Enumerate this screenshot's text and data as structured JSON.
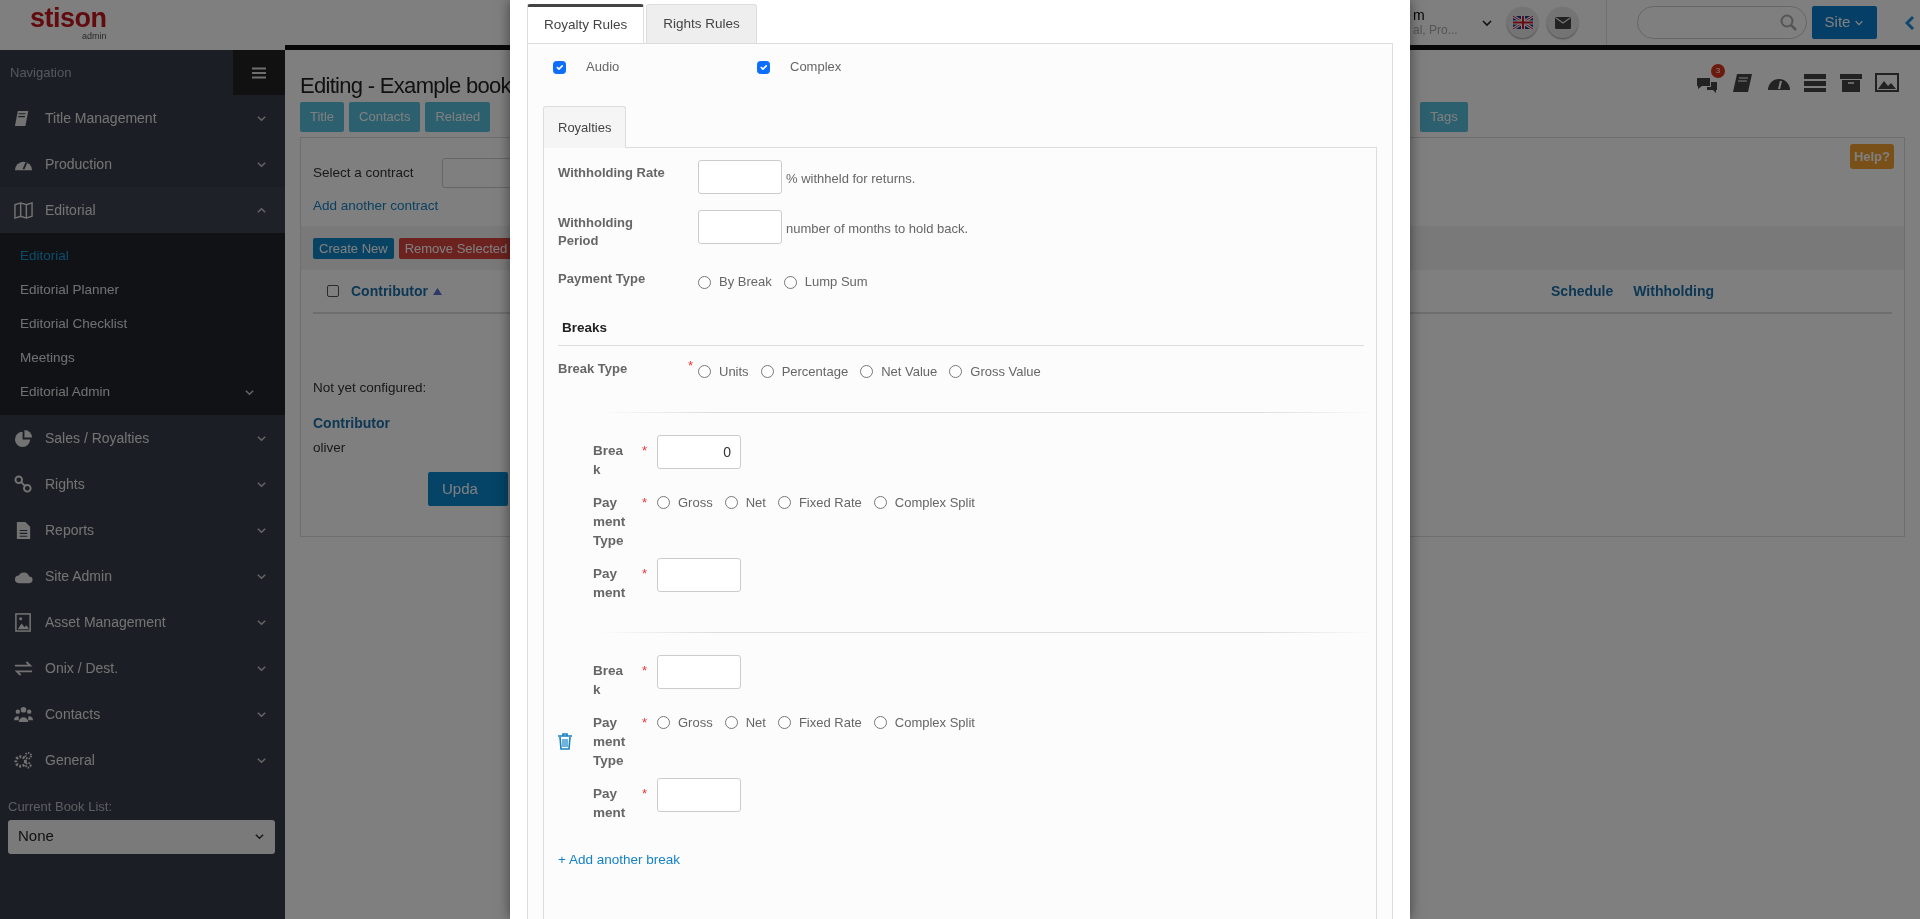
{
  "header": {
    "logo": "stison",
    "logo_sub": "admin",
    "user_name": "m",
    "user_detail": "al, Pro...",
    "site_button": "Site"
  },
  "sidebar": {
    "title": "Navigation",
    "items": [
      {
        "label": "Title Management",
        "expanded": false
      },
      {
        "label": "Production",
        "expanded": false
      },
      {
        "label": "Editorial",
        "expanded": true,
        "children": [
          {
            "label": "Editorial",
            "selected": true
          },
          {
            "label": "Editorial Planner",
            "selected": false
          },
          {
            "label": "Editorial Checklist",
            "selected": false
          },
          {
            "label": "Meetings",
            "selected": false
          },
          {
            "label": "Editorial Admin",
            "selected": false,
            "expanded": false
          }
        ]
      },
      {
        "label": "Sales / Royalties",
        "expanded": false
      },
      {
        "label": "Rights",
        "expanded": false
      },
      {
        "label": "Reports",
        "expanded": false
      },
      {
        "label": "Site Admin",
        "expanded": false
      },
      {
        "label": "Asset Management",
        "expanded": false
      },
      {
        "label": "Onix / Dest.",
        "expanded": false
      },
      {
        "label": "Contacts",
        "expanded": false
      },
      {
        "label": "General",
        "expanded": false
      }
    ],
    "book_list": {
      "label": "Current Book List:",
      "value": "None"
    }
  },
  "page": {
    "title": "Editing - Example book",
    "notification_count": "3",
    "tabs_left": [
      "Title",
      "Contacts",
      "Related"
    ],
    "tabs_right": [
      "Tags"
    ],
    "help": "Help?",
    "select_all": {
      "checked": false
    },
    "contract_label": "Select a contract",
    "add_contract": "Add another contract",
    "buttons": [
      {
        "label": "Create New",
        "kind": "primary"
      },
      {
        "label": "Remove Selected",
        "kind": "danger"
      }
    ],
    "columns": [
      {
        "label": "Contributor",
        "sorted": true
      },
      {
        "label": "Schedule",
        "sorted": false
      },
      {
        "label": "Withholding",
        "sorted": false
      }
    ],
    "not_configured": "Not yet configured:",
    "contributor_heading": "Contributor",
    "contributor": "oliver",
    "update_button": "Upda"
  },
  "modal": {
    "tabs": [
      {
        "label": "Royalty Rules",
        "selected": true
      },
      {
        "label": "Rights Rules",
        "selected": false
      }
    ],
    "options": [
      {
        "label": "Audio",
        "checked": true
      },
      {
        "label": "Complex",
        "checked": true
      }
    ],
    "inner_tabs": [
      {
        "label": "Royalties",
        "selected": true
      }
    ],
    "withholding_rate": {
      "label": "Withholding Rate",
      "hint": "% withheld for returns."
    },
    "withholding_period": {
      "label": "Withholding Period",
      "hint": "number of months to hold back."
    },
    "payment_type": {
      "label": "Payment Type",
      "options": [
        {
          "label": "By Break",
          "selected": false
        },
        {
          "label": "Lump Sum",
          "selected": false
        }
      ]
    },
    "breaks_heading": "Breaks",
    "break_type": {
      "label": "Break Type",
      "required_mark": "*",
      "options": [
        {
          "label": "Units",
          "selected": false
        },
        {
          "label": "Percentage",
          "selected": false
        },
        {
          "label": "Net Value",
          "selected": false
        },
        {
          "label": "Gross Value",
          "selected": false
        }
      ]
    },
    "breaks": [
      {
        "deletable": false,
        "fields": [
          {
            "kind": "input",
            "label": "Break",
            "required_mark": "*",
            "value": "0"
          },
          {
            "kind": "radios",
            "label": "Payment Type",
            "required_mark": "*",
            "options": [
              {
                "label": "Gross",
                "selected": false
              },
              {
                "label": "Net",
                "selected": false
              },
              {
                "label": "Fixed Rate",
                "selected": false
              },
              {
                "label": "Complex Split",
                "selected": false
              }
            ]
          },
          {
            "kind": "input",
            "label": "Payment",
            "required_mark": "*"
          }
        ]
      },
      {
        "deletable": true,
        "fields": [
          {
            "kind": "input",
            "label": "Break",
            "required_mark": "*"
          },
          {
            "kind": "radios",
            "label": "Payment Type",
            "required_mark": "*",
            "options": [
              {
                "label": "Gross",
                "selected": false
              },
              {
                "label": "Net",
                "selected": false
              },
              {
                "label": "Fixed Rate",
                "selected": false
              },
              {
                "label": "Complex Split",
                "selected": false
              }
            ]
          },
          {
            "kind": "input",
            "label": "Payment",
            "required_mark": "*"
          }
        ]
      }
    ],
    "add_break": "+ Add another break"
  }
}
